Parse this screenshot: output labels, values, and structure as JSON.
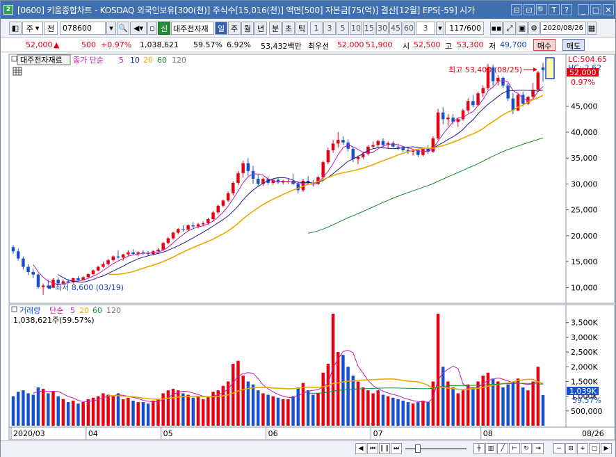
{
  "window": {
    "app_badge": "2",
    "title": "[0600] 키움종합차트 - KOSDAQ 외국인보유[300(천)] 주식수[15,016(천)] 액면[500] 자본금[75(억)] 결산[12월] EPS[-59] 시가",
    "title_buttons": [
      "⊟",
      "⊡",
      "🔍",
      "T",
      "?",
      "_",
      "□",
      "✕"
    ]
  },
  "toolbar": {
    "period_label": "주",
    "all_label": "전",
    "code": "078600",
    "new_label": "신",
    "stock_name": "대주전자재",
    "period_tabs": [
      "일",
      "주",
      "월",
      "년",
      "분",
      "초",
      "틱"
    ],
    "active_period": "일",
    "intervals": [
      "1",
      "3",
      "5",
      "10",
      "15",
      "30",
      "45",
      "60"
    ],
    "interval_value": "3",
    "count": "117/600",
    "date": "2020/08/26"
  },
  "quote": {
    "price": "52,000",
    "up_mark": "▲",
    "change": "500",
    "change_pct": "+0.97%",
    "volume": "1,038,621",
    "vol_ratio": "59.57%",
    "turnover": "6.92%",
    "amount": "53,432백만",
    "label_best": "최우선",
    "ask": "52,000",
    "bid": "51,900",
    "open_label": "시",
    "open": "52,500",
    "high_label": "고",
    "high": "53,300",
    "low_label": "저",
    "low": "49,700",
    "buy_label": "매수",
    "sell_label": "매도"
  },
  "price_panel": {
    "stock_label": "대주전자재료",
    "ma_title": "종가 단순",
    "ma_periods": [
      "5",
      "10",
      "20",
      "60",
      "120"
    ],
    "lc_label": "LC:504.65",
    "hc_label": "HC:-2.62",
    "current_price_tag": "52,000",
    "current_pct_tag": "0.97%",
    "high_note": "최고 53,400 (08/25)",
    "low_note": "최저 8,600 (03/19)",
    "y_ticks": [
      "45,000",
      "40,000",
      "35,000",
      "30,000",
      "25,000",
      "20,000",
      "15,000",
      "10,000"
    ]
  },
  "volume_panel": {
    "title": "거래량",
    "ma_title": "단순",
    "ma_periods": [
      "5",
      "20",
      "60",
      "120"
    ],
    "value_label": "1,038,621주(59.57%)",
    "current_tag": "1,039K",
    "current_pct": "59.57%",
    "y_ticks": [
      "3,500K",
      "3,000K",
      "2,500K",
      "2,000K",
      "1,500K",
      "1,000K",
      "500,000"
    ]
  },
  "x_axis": {
    "labels": [
      "2020/03",
      "04",
      "05",
      "06",
      "07",
      "08"
    ],
    "right_label": "08/26"
  },
  "colors": {
    "up": "#e60012",
    "down": "#1650d0",
    "ma5": "#c21bb5",
    "ma10": "#1a1a8c",
    "ma20": "#e8a800",
    "ma60": "#138a30",
    "ma120": "#777777",
    "titlebar": "#3f6fb0"
  },
  "chart_data": {
    "type": "candlestick",
    "y_range": [
      7500,
      54500
    ],
    "volume_range": [
      0,
      3800000
    ],
    "candles": [
      [
        17800,
        18200,
        16500,
        17000,
        1000000
      ],
      [
        17000,
        17500,
        15200,
        15600,
        1150000
      ],
      [
        15600,
        16000,
        13500,
        14000,
        1200000
      ],
      [
        14000,
        14500,
        12400,
        13000,
        1100000
      ],
      [
        13000,
        13600,
        11800,
        12500,
        1050000
      ],
      [
        12500,
        12800,
        9800,
        10100,
        1300000
      ],
      [
        10100,
        10800,
        8600,
        10400,
        1250000
      ],
      [
        10400,
        11500,
        9700,
        10000,
        1100000
      ],
      [
        10000,
        11800,
        9900,
        11500,
        1150000
      ],
      [
        11500,
        12000,
        10600,
        10800,
        1000000
      ],
      [
        10800,
        11500,
        10500,
        11200,
        900000
      ],
      [
        11200,
        11600,
        10800,
        11000,
        800000
      ],
      [
        11000,
        11900,
        10800,
        11800,
        850000
      ],
      [
        11800,
        12200,
        11200,
        11400,
        750000
      ],
      [
        11400,
        12200,
        11300,
        12000,
        800000
      ],
      [
        12000,
        12800,
        11900,
        12600,
        900000
      ],
      [
        12600,
        13500,
        12400,
        13300,
        950000
      ],
      [
        13300,
        14200,
        13100,
        14000,
        1000000
      ],
      [
        14000,
        15000,
        13800,
        14500,
        1100000
      ],
      [
        14500,
        15500,
        14300,
        15300,
        1050000
      ],
      [
        15300,
        16200,
        15000,
        16000,
        1000000
      ],
      [
        16000,
        17200,
        15500,
        15800,
        1100000
      ],
      [
        15800,
        16500,
        15200,
        16400,
        900000
      ],
      [
        16400,
        17200,
        16000,
        16800,
        950000
      ],
      [
        16800,
        17400,
        16200,
        16500,
        850000
      ],
      [
        16500,
        17000,
        16000,
        16800,
        800000
      ],
      [
        16800,
        17200,
        16300,
        16600,
        800000
      ],
      [
        16600,
        17000,
        16100,
        16500,
        750000
      ],
      [
        16500,
        17200,
        16200,
        17000,
        850000
      ],
      [
        17000,
        17600,
        16700,
        17300,
        900000
      ],
      [
        17300,
        18800,
        17100,
        18600,
        1100000
      ],
      [
        18600,
        19800,
        18400,
        19500,
        1200000
      ],
      [
        19500,
        20800,
        19200,
        20600,
        1250000
      ],
      [
        20600,
        21500,
        20300,
        21300,
        1200000
      ],
      [
        21300,
        22000,
        20800,
        21200,
        1100000
      ],
      [
        21200,
        22200,
        21000,
        22000,
        1050000
      ],
      [
        22000,
        22600,
        21500,
        21800,
        950000
      ],
      [
        21800,
        22500,
        21400,
        22200,
        1000000
      ],
      [
        22200,
        22800,
        21800,
        22400,
        900000
      ],
      [
        22400,
        23500,
        22100,
        23200,
        1000000
      ],
      [
        23200,
        24800,
        22900,
        24500,
        1150000
      ],
      [
        24500,
        26000,
        24200,
        25800,
        1200000
      ],
      [
        25800,
        27000,
        25500,
        26800,
        1350000
      ],
      [
        26800,
        28500,
        26500,
        28200,
        1500000
      ],
      [
        28200,
        30500,
        27800,
        30200,
        2100000
      ],
      [
        30200,
        32500,
        29800,
        32100,
        2200000
      ],
      [
        32100,
        34500,
        31200,
        34000,
        1700000
      ],
      [
        34000,
        35000,
        31500,
        32500,
        1500000
      ],
      [
        32500,
        33500,
        30000,
        31000,
        1400000
      ],
      [
        31000,
        31800,
        29500,
        30000,
        1200000
      ],
      [
        30000,
        31200,
        29600,
        31000,
        1100000
      ],
      [
        31000,
        31500,
        29800,
        30200,
        1050000
      ],
      [
        30200,
        31000,
        29800,
        30800,
        1000000
      ],
      [
        30800,
        31200,
        30000,
        30300,
        950000
      ],
      [
        30300,
        30800,
        29900,
        30500,
        900000
      ],
      [
        30500,
        31000,
        30000,
        30600,
        900000
      ],
      [
        30600,
        32000,
        29800,
        30000,
        1000000
      ],
      [
        30000,
        30500,
        28200,
        28800,
        1300000
      ],
      [
        28800,
        31000,
        28500,
        30600,
        1450000
      ],
      [
        30600,
        31500,
        29800,
        30200,
        1200000
      ],
      [
        30200,
        30800,
        29500,
        30000,
        1050000
      ],
      [
        30000,
        31500,
        29800,
        31300,
        1100000
      ],
      [
        31300,
        34500,
        31000,
        34200,
        1800000
      ],
      [
        34200,
        37000,
        33800,
        36500,
        2100000
      ],
      [
        36500,
        38500,
        36000,
        37800,
        3800000
      ],
      [
        37800,
        40000,
        37000,
        38500,
        2500000
      ],
      [
        38500,
        39200,
        37500,
        38000,
        2400000
      ],
      [
        38000,
        38600,
        36200,
        36800,
        2000000
      ],
      [
        36800,
        37200,
        34200,
        34800,
        1700000
      ],
      [
        34800,
        35500,
        33800,
        35200,
        1500000
      ],
      [
        35200,
        36200,
        34800,
        35800,
        1300000
      ],
      [
        35800,
        37500,
        35500,
        37200,
        1200000
      ],
      [
        37200,
        38200,
        36800,
        37500,
        1100000
      ],
      [
        37500,
        38500,
        37200,
        38300,
        1200000
      ],
      [
        38300,
        38800,
        37200,
        37500,
        1050000
      ],
      [
        37500,
        38200,
        36800,
        37900,
        1000000
      ],
      [
        37900,
        38300,
        37000,
        37200,
        950000
      ],
      [
        37200,
        37800,
        36500,
        37000,
        900000
      ],
      [
        37000,
        37400,
        36200,
        36500,
        850000
      ],
      [
        36500,
        37000,
        35800,
        36200,
        800000
      ],
      [
        36200,
        36800,
        35500,
        36500,
        750000
      ],
      [
        36500,
        36800,
        35200,
        35600,
        800000
      ],
      [
        35600,
        37000,
        35300,
        36800,
        850000
      ],
      [
        36800,
        37500,
        35800,
        36200,
        800000
      ],
      [
        36200,
        39200,
        36000,
        38800,
        1500000
      ],
      [
        38800,
        44500,
        38500,
        43800,
        3800000
      ],
      [
        43800,
        44800,
        41500,
        42500,
        2000000
      ],
      [
        42500,
        43500,
        41200,
        42800,
        1500000
      ],
      [
        42800,
        43500,
        41500,
        42000,
        1300000
      ],
      [
        42000,
        42800,
        41000,
        42500,
        1100000
      ],
      [
        42500,
        44500,
        42200,
        44200,
        1200000
      ],
      [
        44200,
        46500,
        43800,
        46000,
        1400000
      ],
      [
        46000,
        47200,
        44800,
        45200,
        1300000
      ],
      [
        45200,
        47800,
        45000,
        47500,
        1500000
      ],
      [
        47500,
        49000,
        46800,
        48500,
        1700000
      ],
      [
        48500,
        53200,
        48200,
        52500,
        1800000
      ],
      [
        52500,
        53000,
        49000,
        49800,
        1600000
      ],
      [
        49800,
        51000,
        49000,
        50500,
        1500000
      ],
      [
        50500,
        50800,
        48500,
        49000,
        1300000
      ],
      [
        49000,
        49500,
        46000,
        46500,
        1400000
      ],
      [
        46500,
        47500,
        43500,
        44200,
        1500000
      ],
      [
        44200,
        47500,
        44000,
        47200,
        1600000
      ],
      [
        47200,
        47800,
        45000,
        45500,
        1300000
      ],
      [
        45500,
        47000,
        45200,
        46800,
        1200000
      ],
      [
        46800,
        49500,
        46500,
        48200,
        1500000
      ],
      [
        48200,
        51800,
        48000,
        51500,
        2000000
      ],
      [
        52500,
        53400,
        49700,
        52000,
        1038621
      ]
    ]
  }
}
